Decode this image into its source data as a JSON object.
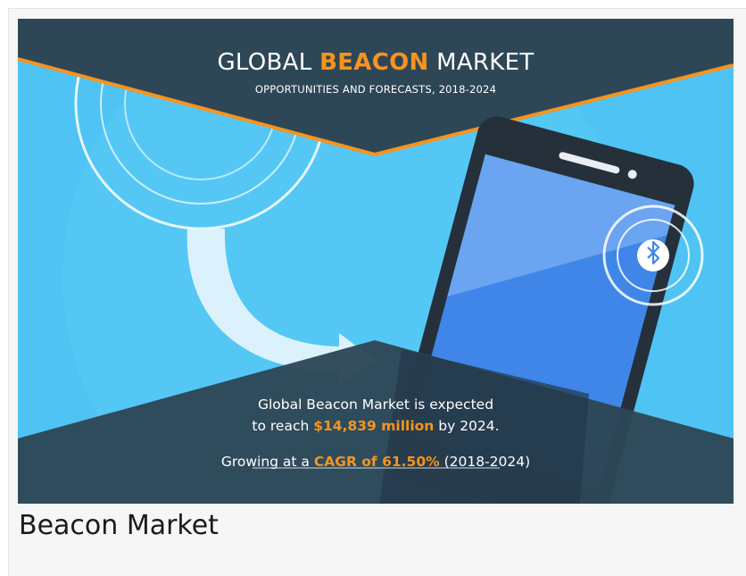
{
  "banner": {
    "title_prefix": "GLOBAL ",
    "title_highlight": "BEACON",
    "title_suffix": " MARKET",
    "subtitle": "OPPORTUNITIES AND FORECASTS, 2018-2024",
    "line1": "Global Beacon Market is expected",
    "line2_prefix": "to reach ",
    "line2_highlight": "$14,839 million",
    "line2_suffix": " by 2024.",
    "line3_prefix": "Growing at a ",
    "line3_highlight": "CAGR of 61.50%",
    "line3_suffix": " (2018-2024)"
  },
  "caption": "Beacon Market",
  "colors": {
    "sky": "#4fc3f4",
    "dark": "#2e4756",
    "accent": "#f7941d",
    "screen": "#3f86e8"
  },
  "icons": [
    "bluetooth-icon",
    "phone-illustration",
    "arrow-illustration"
  ]
}
